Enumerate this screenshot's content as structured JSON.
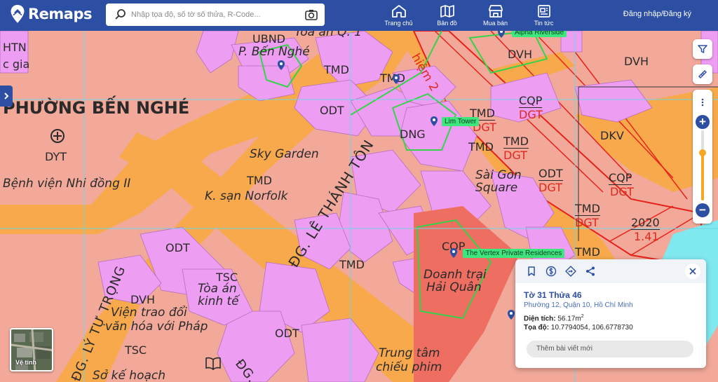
{
  "header": {
    "brand": "Remaps",
    "search_placeholder": "Nhập tọa độ, số tờ số thửa, R-Code...",
    "nav": [
      {
        "label": "Trang chủ",
        "icon": "home-icon"
      },
      {
        "label": "Bản đồ",
        "icon": "map-icon"
      },
      {
        "label": "Mua bán",
        "icon": "store-icon"
      },
      {
        "label": "Tin tức",
        "icon": "news-icon"
      }
    ],
    "login_label": "Đăng nhập/Đăng ký",
    "accent_color": "#2d4fa3"
  },
  "map": {
    "colors": {
      "residential": "#f2a99a",
      "road": "#f7a94b",
      "lot": "#ee9ef2",
      "park": "#ee6f62",
      "boundary": "#e6231b",
      "green_outline": "#35d34a",
      "water": "#7fe9ef"
    },
    "labels": {
      "ward": "PHƯỜNG BẾN NGHÉ",
      "htn": "HTN",
      "cgia": "c gia",
      "ubnd": "UBND",
      "p_ben_nghe": "P. Bến Nghé",
      "toa_an_q1": "Tòa án Q. 1",
      "tmd1": "TMD",
      "tmd2": "TMD",
      "odt1": "ODT",
      "dng": "DNG",
      "dyt": "DYT",
      "benh_vien": "Bệnh viện Nhi đồng II",
      "sky_garden": "Sky Garden",
      "tmd3": "TMD",
      "ks_norfolk": "K. sạn Norfolk",
      "street_lth": "ĐG. LÊ THÁNH TÔN",
      "odt2": "ODT",
      "tsc1": "TSC",
      "toa_an_kt": "Tòa án",
      "toa_an_kt2": "kinh tế",
      "dvh1": "DVH",
      "vien_trao_doi": "Viện trao đổi",
      "van_hoa": "văn hóa với Pháp",
      "tsc2": "TSC",
      "so_ke_hoach": "Sở kế hoạch",
      "street_ltt": "ĐG. LÝ TỰ TRỌNG",
      "street_dgt": "ĐG. T",
      "odt3": "ODT",
      "tmd4": "TMD",
      "cqp1": "CQP",
      "doanh_trai": "Doanh trại",
      "hai_quan": "Hải Quân",
      "trung_tam": "Trung tâm",
      "chieu_phim": "chiếu phim",
      "dvh2": "DVH",
      "dvh3": "DVH",
      "dkv": "DKV",
      "tmd5": "TMD",
      "dgt1": "DGT",
      "cqp2": "CQP",
      "dgt2": "DGT",
      "tmd6": "TMD",
      "tmd7": "TMD",
      "dgt3": "DGT",
      "sai_gon": "Sài Gòn",
      "square": "Square",
      "odt4": "ODT",
      "dgt4": "DGT",
      "cqp3": "CQP",
      "dgt5": "DGT",
      "tmd8": "TMD",
      "dgt6": "DGT",
      "y2020": "2020",
      "n141": "1.41",
      "tmd9": "TMD",
      "hiem2": "hiệm 2"
    },
    "pois": {
      "alpha": "Alpha Riverside",
      "lim": "Lim Tower",
      "vertex": "The Vertex Private Residences"
    }
  },
  "satellite_label": "Vệ tinh",
  "zoom": {
    "level": 0.68
  },
  "info_card": {
    "title": "Tờ 31 Thửa 46",
    "address": "Phường 12, Quận 10, Hồ Chí Minh",
    "area_label": "Diện tích:",
    "area_value": "56.17m",
    "area_unit_sup": "2",
    "coord_label": "Tọa độ:",
    "coord_value": "10.7794054, 106.6778730",
    "post_placeholder": "Thêm bài viết mới"
  }
}
